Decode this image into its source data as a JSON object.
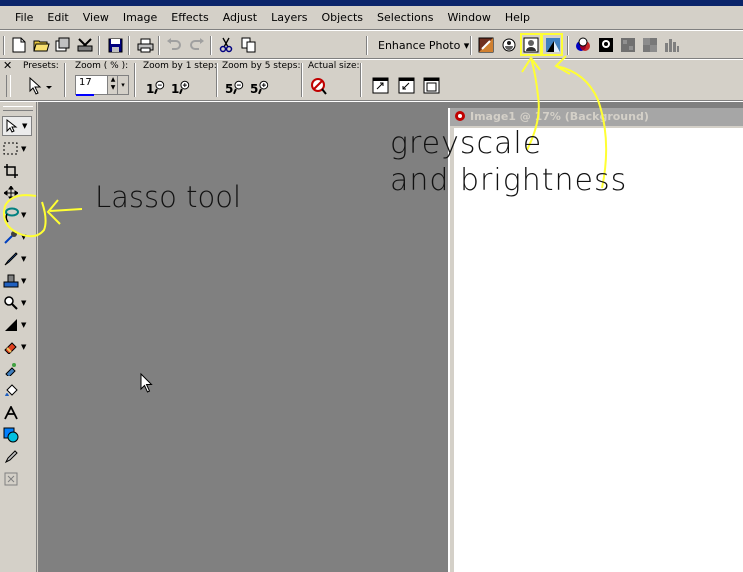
{
  "menu": [
    "File",
    "Edit",
    "View",
    "Image",
    "Effects",
    "Adjust",
    "Layers",
    "Objects",
    "Selections",
    "Window",
    "Help"
  ],
  "toolbar": {
    "enhance_photo": "Enhance Photo ▾"
  },
  "options": {
    "presets_label": "Presets:",
    "zoom_label": "Zoom ( % ):",
    "zoom_value": "17",
    "zoom1_label": "Zoom by 1 step:",
    "zoom5_label": "Zoom by 5 steps:",
    "actual_label": "Actual size:",
    "zoom1_minus": "1",
    "zoom1_plus": "1",
    "zoom5_minus": "5",
    "zoom5_plus": "5"
  },
  "image_window": {
    "title": "Image1 @ 17% (Background)"
  },
  "annotations": {
    "lasso": "Lasso tool",
    "greyscale": "greyscale",
    "brightness": "and brightness"
  },
  "colors": {
    "highlight": "#ffff33",
    "workspace": "#808080",
    "chrome": "#d4d0c8"
  }
}
